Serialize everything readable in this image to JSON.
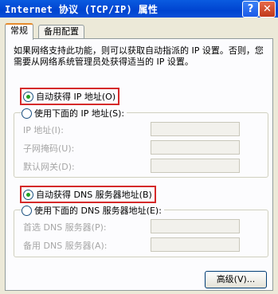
{
  "window": {
    "title": "Internet 协议 (TCP/IP) 属性",
    "help_glyph": "?",
    "close_glyph": "✕"
  },
  "tabs": [
    "常规",
    "备用配置"
  ],
  "description": "如果网络支持此功能，则可以获取自动指派的 IP 设置。否则，您需要从网络系统管理员处获得适当的 IP 设置。",
  "ip_section": {
    "auto_label": "自动获得 IP 地址(O)",
    "manual_label": "使用下面的 IP 地址(S):",
    "fields": [
      {
        "label": "IP 地址(I):",
        "value": ""
      },
      {
        "label": "子网掩码(U):",
        "value": ""
      },
      {
        "label": "默认网关(D):",
        "value": ""
      }
    ],
    "auto_selected": true
  },
  "dns_section": {
    "auto_label": "自动获得 DNS 服务器地址(B)",
    "manual_label": "使用下面的 DNS 服务器地址(E):",
    "fields": [
      {
        "label": "首选 DNS 服务器(P):",
        "value": ""
      },
      {
        "label": "备用 DNS 服务器(A):",
        "value": ""
      }
    ],
    "auto_selected": true
  },
  "advanced_button": "高级(V)...",
  "colors": {
    "titlebar": "#0a5be0",
    "highlight": "#d52a2a",
    "selected_tab_accent": "#e68b2c",
    "radio_dot": "#21a121"
  }
}
